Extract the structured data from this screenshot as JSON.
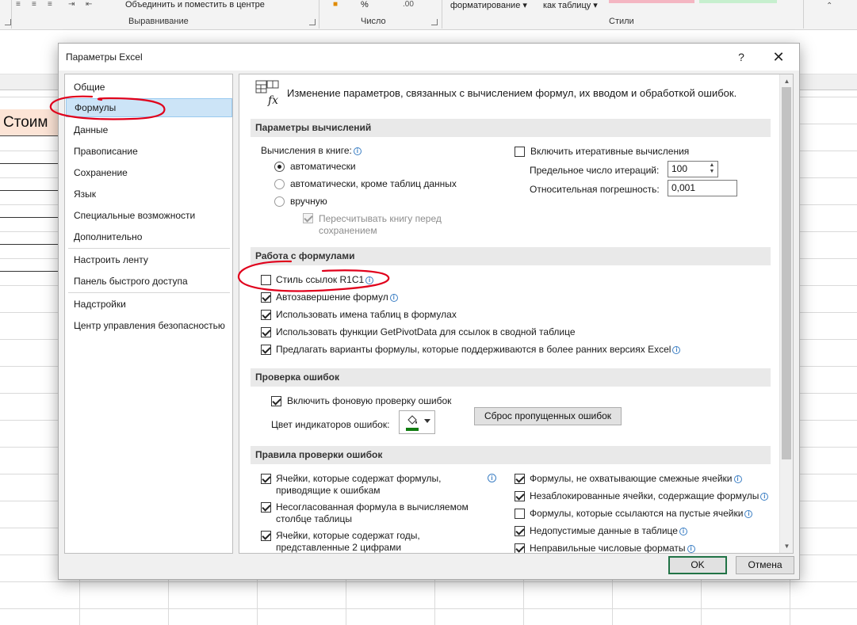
{
  "ribbon": {
    "top_left_text": "Объединить и поместить в центре",
    "top_percent": "%",
    "top_format_table": "форматирование",
    "top_as_table": "как таблицу",
    "group_alignment": "Выравнивание",
    "group_number": "Число",
    "group_styles": "Стили"
  },
  "sheet": {
    "cell_text": "Стоим"
  },
  "dialog": {
    "title": "Параметры Excel",
    "help": "?",
    "close": "✕",
    "nav": [
      "Общие",
      "Формулы",
      "Данные",
      "Правописание",
      "Сохранение",
      "Язык",
      "Специальные возможности",
      "Дополнительно",
      "Настроить ленту",
      "Панель быстрого доступа",
      "Надстройки",
      "Центр управления безопасностью"
    ],
    "header_text": "Изменение параметров, связанных с вычислением формул, их вводом и обработкой ошибок.",
    "calc": {
      "section": "Параметры вычислений",
      "workbook_label": "Вычисления в книге:",
      "opt_auto": "автоматически",
      "opt_auto_except": "автоматически, кроме таблиц данных",
      "opt_manual": "вручную",
      "recalc_before_save_line1": "Пересчитывать книгу перед",
      "recalc_before_save_line2": "сохранением",
      "iterative": "Включить итеративные вычисления",
      "max_iter_label": "Предельное число итераций:",
      "max_iter_value": "100",
      "max_change_label": "Относительная погрешность:",
      "max_change_value": "0,001"
    },
    "formulas": {
      "section": "Работа с формулами",
      "r1c1": "Стиль ссылок R1C1",
      "autocomplete": "Автозавершение формул",
      "table_names": "Использовать имена таблиц в формулах",
      "getpivot": "Использовать функции GetPivotData для ссылок в сводной таблице",
      "suggest": "Предлагать варианты формулы, которые поддерживаются в более ранних версиях Excel"
    },
    "errors": {
      "section": "Проверка ошибок",
      "background": "Включить фоновую проверку ошибок",
      "color_label": "Цвет индикаторов ошибок:",
      "reset_button": "Сброс пропущенных ошибок"
    },
    "rules": {
      "section": "Правила проверки ошибок",
      "left": [
        [
          "Ячейки, которые содержат формулы,",
          "приводящие к ошибкам"
        ],
        [
          "Несогласованная формула в вычисляемом",
          "столбце таблицы"
        ],
        [
          "Ячейки, которые содержат годы,",
          "представленные 2 цифрами"
        ]
      ],
      "right": [
        "Формулы, не охватывающие смежные ячейки",
        "Незаблокированные ячейки, содержащие формулы",
        "Формулы, которые ссылаются на пустые ячейки",
        "Недопустимые данные в таблице",
        "Неправильные числовые форматы"
      ]
    },
    "ok": "OK",
    "cancel": "Отмена"
  },
  "colors": {
    "selected_nav": "#cce4f7",
    "error_indicator": "#107c10",
    "annotation": "#e0001b",
    "ok_border": "#217346"
  }
}
